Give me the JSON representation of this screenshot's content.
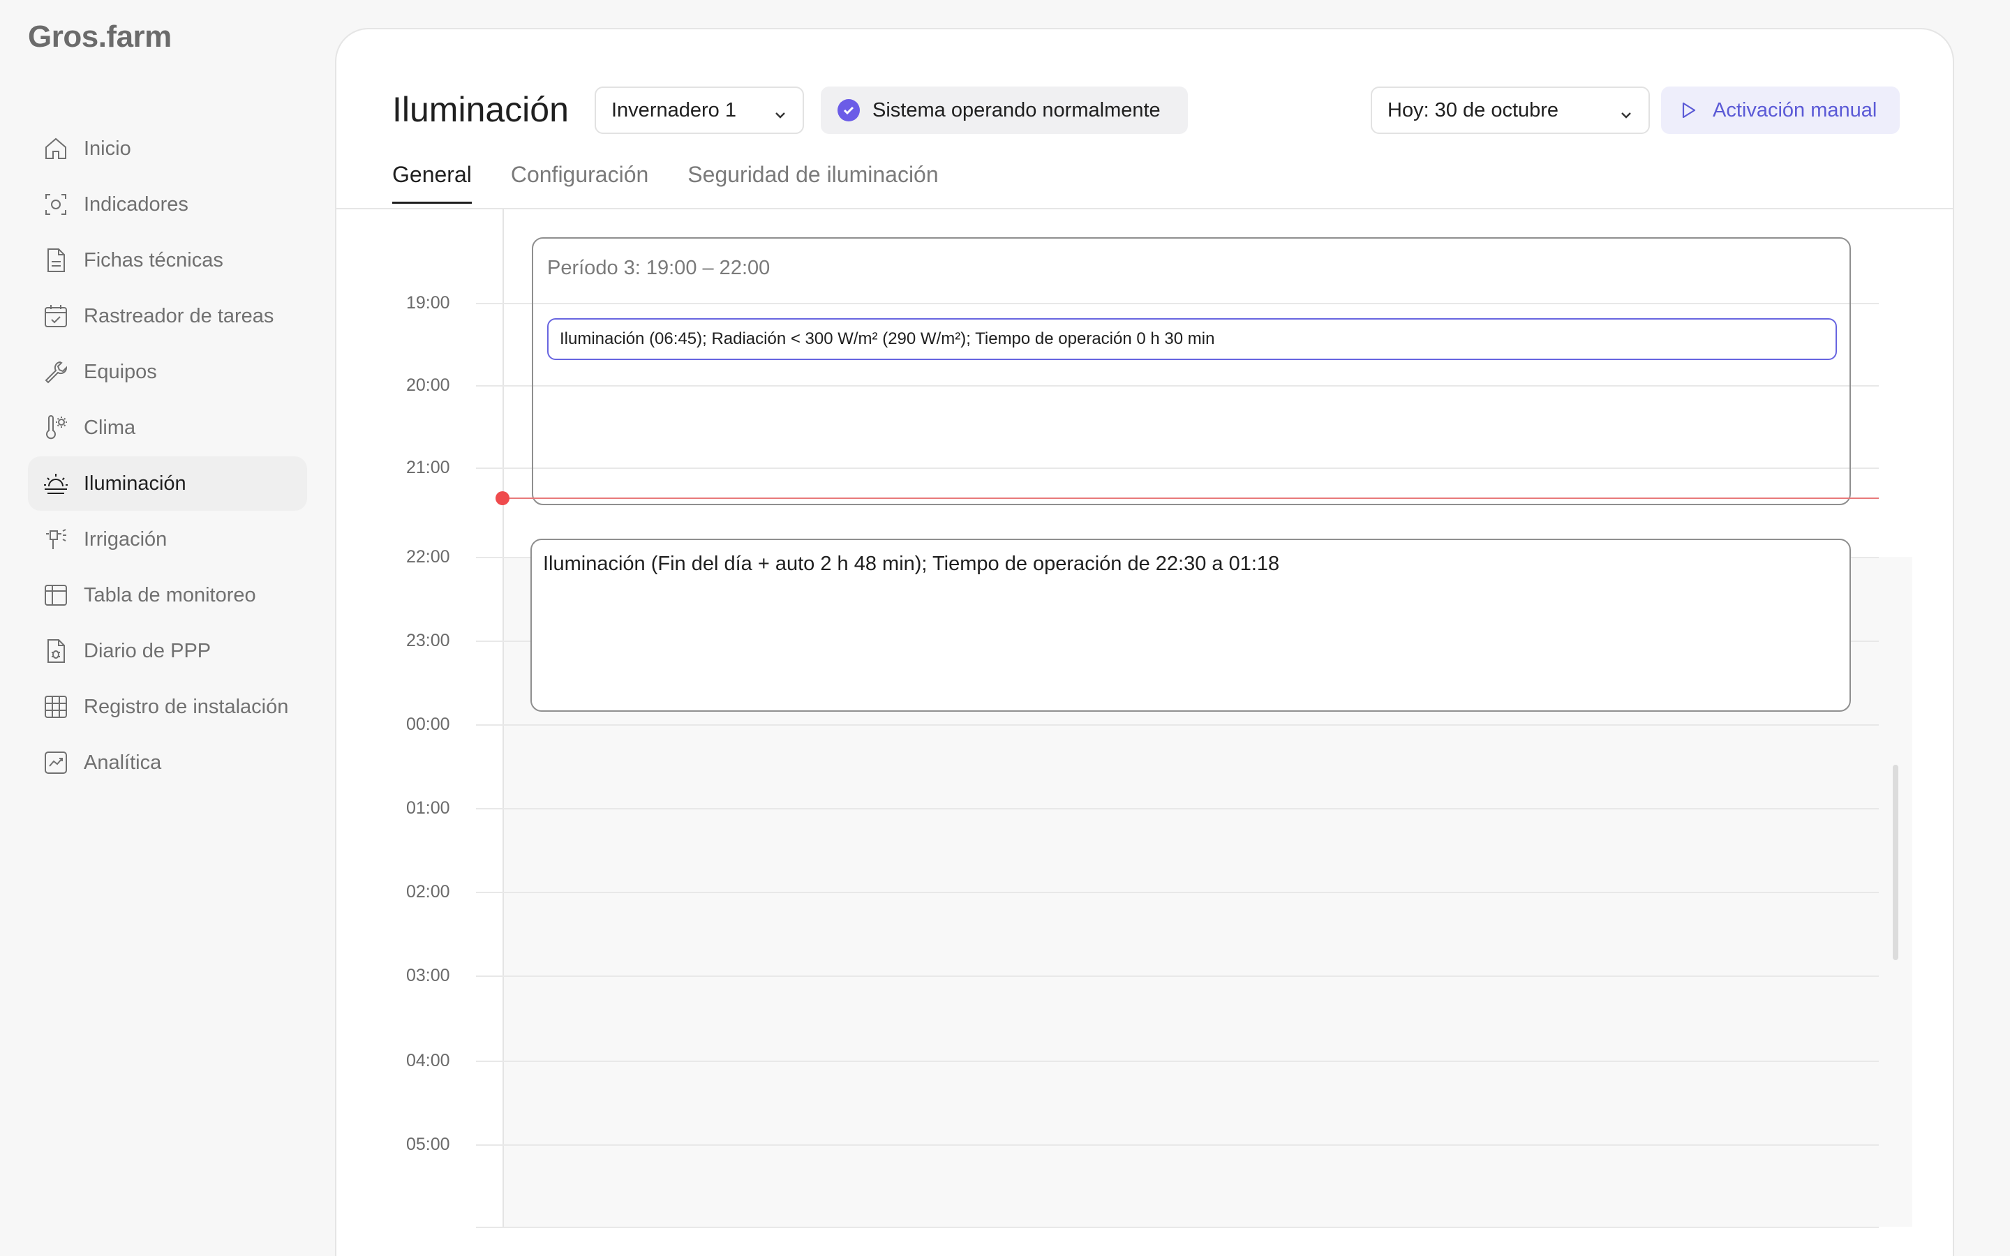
{
  "app": {
    "logo": "Gros.farm"
  },
  "sidebar": {
    "items": [
      {
        "label": "Inicio",
        "icon": "home-icon",
        "active": false
      },
      {
        "label": "Indicadores",
        "icon": "indicators-icon",
        "active": false
      },
      {
        "label": "Fichas técnicas",
        "icon": "document-icon",
        "active": false
      },
      {
        "label": "Rastreador de tareas",
        "icon": "calendar-check-icon",
        "active": false
      },
      {
        "label": "Equipos",
        "icon": "wrench-icon",
        "active": false
      },
      {
        "label": "Clima",
        "icon": "thermometer-sun-icon",
        "active": false
      },
      {
        "label": "Iluminación",
        "icon": "sunrise-icon",
        "active": true
      },
      {
        "label": "Irrigación",
        "icon": "sprinkler-icon",
        "active": false
      },
      {
        "label": "Tabla de monitoreo",
        "icon": "table-icon",
        "active": false
      },
      {
        "label": "Diario de PPP",
        "icon": "bug-document-icon",
        "active": false
      },
      {
        "label": "Registro de instalación",
        "icon": "grid-icon",
        "active": false
      },
      {
        "label": "Analítica",
        "icon": "chart-icon",
        "active": false
      }
    ]
  },
  "header": {
    "title": "Iluminación",
    "greenhouse_select": "Invernadero 1",
    "status": "Sistema operando normalmente",
    "date_select": "Hoy: 30 de octubre",
    "manual_button": "Activación manual"
  },
  "tabs": [
    {
      "label": "General",
      "active": true
    },
    {
      "label": "Configuración",
      "active": false
    },
    {
      "label": "Seguridad de iluminación",
      "active": false
    }
  ],
  "timeline": {
    "hours": [
      "19:00",
      "20:00",
      "21:00",
      "22:00",
      "23:00",
      "00:00",
      "01:00",
      "02:00",
      "03:00",
      "04:00",
      "05:00"
    ],
    "period": {
      "label": "Período 3: 19:00 – 22:00",
      "event": "Iluminación (06:45); Radiación < 300 W/m² (290 W/m²); Tiempo de operación 0 h 30 min"
    },
    "end_of_day_event": "Iluminación (Fin del día + auto 2 h 48 min); Tiempo de operación de 22:30 a 01:18"
  },
  "colors": {
    "accent": "#6865e0",
    "now_line": "#ef4b4d",
    "status_check": "#6b5ce7"
  }
}
